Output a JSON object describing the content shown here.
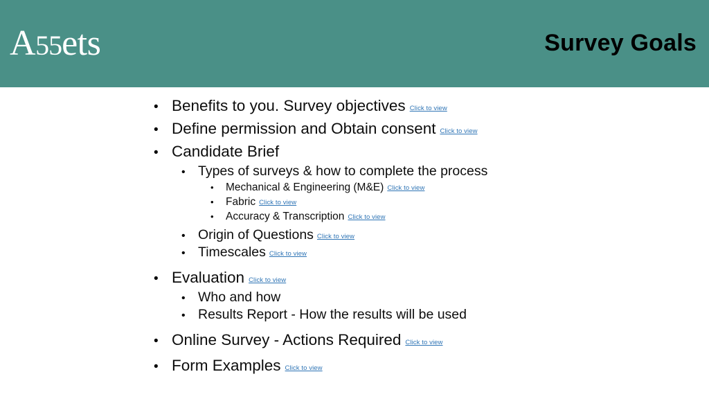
{
  "slide": {
    "brand_color": "#4a9087",
    "link_color": "#2e74b5",
    "text_color": "#0d0d0d",
    "background": "#ffffff",
    "logo": {
      "full_text": "A55ets",
      "prefix": "A",
      "digits": "55",
      "suffix": "ets"
    },
    "title": "Survey Goals",
    "bullet_glyph": "•",
    "link_label": "Click to view",
    "outline": [
      {
        "level": 1,
        "text": "Benefits to you. Survey objectives",
        "link": "Click to view"
      },
      {
        "level": 1,
        "text": "Define permission and Obtain consent",
        "link": "Click to view"
      },
      {
        "level": 1,
        "text": "Candidate Brief",
        "link": ""
      },
      {
        "level": 2,
        "text": "Types of surveys & how to complete the process",
        "link": ""
      },
      {
        "level": 3,
        "text": "Mechanical & Engineering (M&E)",
        "link": "Click to view"
      },
      {
        "level": 3,
        "text": "Fabric",
        "link": "Click to view"
      },
      {
        "level": 3,
        "text": "Accuracy & Transcription",
        "link": "Click to view"
      },
      {
        "level": 2,
        "text": "Origin of Questions",
        "link": "Click to view"
      },
      {
        "level": 2,
        "text": "Timescales",
        "link": "Click to view"
      },
      {
        "level": 1,
        "text": "Evaluation",
        "link": "Click to view"
      },
      {
        "level": 2,
        "text": "Who and how",
        "link": ""
      },
      {
        "level": 2,
        "text": "Results Report - How the results will be used",
        "link": ""
      },
      {
        "level": 1,
        "text": "Online Survey - Actions Required",
        "link": "Click to view"
      },
      {
        "level": 1,
        "text": "Form Examples",
        "link": "Click to view"
      }
    ]
  }
}
